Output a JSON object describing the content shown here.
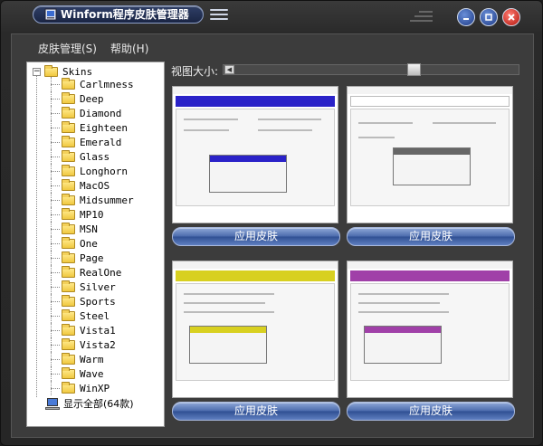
{
  "window": {
    "title": "Winform程序皮肤管理器",
    "icon": "app-icon",
    "controls": {
      "minimize": "minimize-icon",
      "maximize": "maximize-icon",
      "close": "close-icon"
    },
    "colors": {
      "title_accent": "#1a2544",
      "close": "#c0180e",
      "button_blue": "#3a5a9c"
    }
  },
  "menu": {
    "items": [
      {
        "label": "皮肤管理(S)"
      },
      {
        "label": "帮助(H)"
      }
    ]
  },
  "tree": {
    "root": {
      "label": "Skins",
      "expander": "−"
    },
    "items": [
      "Carlmness",
      "Deep",
      "Diamond",
      "Eighteen",
      "Emerald",
      "Glass",
      "Longhorn",
      "MacOS",
      "Midsummer",
      "MP10",
      "MSN",
      "One",
      "Page",
      "RealOne",
      "Silver",
      "Sports",
      "Steel",
      "Vista1",
      "Vista2",
      "Warm",
      "Wave",
      "WinXP"
    ],
    "footer": "显示全部(64款)"
  },
  "view": {
    "size_label": "视图大小:"
  },
  "previews": [
    {
      "accent": "#2a22c8",
      "apply_label": "应用皮肤"
    },
    {
      "accent": "#ffffff",
      "apply_label": "应用皮肤"
    },
    {
      "accent": "#d8d020",
      "apply_label": "应用皮肤"
    },
    {
      "accent": "#a040a8",
      "apply_label": "应用皮肤"
    }
  ]
}
